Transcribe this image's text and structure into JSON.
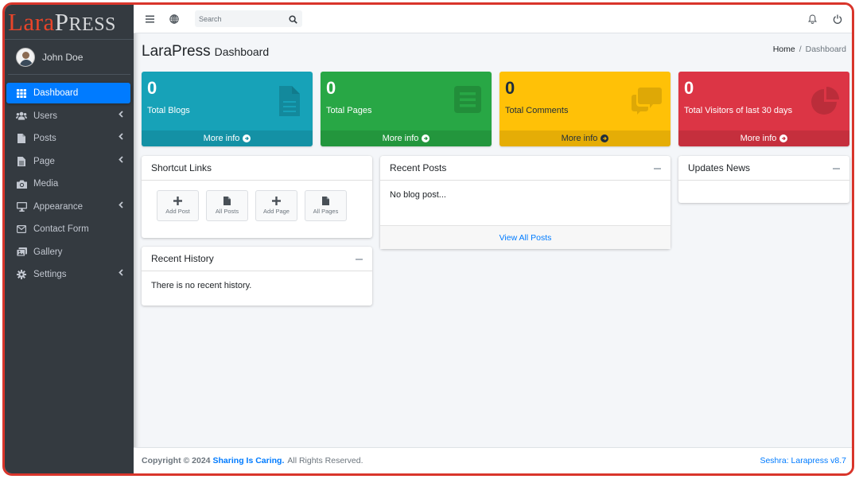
{
  "brand": {
    "part1": "Lara",
    "part2_big": "P",
    "part2_small": "RESS"
  },
  "user": {
    "name": "John Doe"
  },
  "sidebar": {
    "items": [
      {
        "label": "Dashboard",
        "icon": "grid-icon",
        "active": true,
        "has_children": false
      },
      {
        "label": "Users",
        "icon": "users-icon",
        "active": false,
        "has_children": true
      },
      {
        "label": "Posts",
        "icon": "file-icon",
        "active": false,
        "has_children": true
      },
      {
        "label": "Page",
        "icon": "file-icon",
        "active": false,
        "has_children": true
      },
      {
        "label": "Media",
        "icon": "camera-icon",
        "active": false,
        "has_children": false
      },
      {
        "label": "Appearance",
        "icon": "monitor-icon",
        "active": false,
        "has_children": true
      },
      {
        "label": "Contact Form",
        "icon": "envelope-icon",
        "active": false,
        "has_children": false
      },
      {
        "label": "Gallery",
        "icon": "images-icon",
        "active": false,
        "has_children": false
      },
      {
        "label": "Settings",
        "icon": "gear-icon",
        "active": false,
        "has_children": true
      }
    ]
  },
  "topbar": {
    "search_placeholder": "Search"
  },
  "page": {
    "title": "LaraPress",
    "subtitle": "Dashboard"
  },
  "breadcrumb": {
    "home": "Home",
    "separator": "/",
    "current": "Dashboard"
  },
  "stat_boxes": [
    {
      "value": "0",
      "label": "Total Blogs",
      "more": "More info",
      "color": "#17a2b8",
      "text_color": "#ffffff",
      "icon": "document-icon"
    },
    {
      "value": "0",
      "label": "Total Pages",
      "more": "More info",
      "color": "#28a745",
      "text_color": "#ffffff",
      "icon": "list-icon"
    },
    {
      "value": "0",
      "label": "Total Comments",
      "more": "More info",
      "color": "#ffc107",
      "text_color": "#1f2d3d",
      "icon": "comments-icon"
    },
    {
      "value": "0",
      "label": "Total Visitors of last 30 days",
      "more": "More info",
      "color": "#dc3545",
      "text_color": "#ffffff",
      "icon": "pie-chart-icon"
    }
  ],
  "shortcut_links": {
    "title": "Shortcut Links",
    "buttons": [
      {
        "label": "Add Post",
        "icon": "plus-icon"
      },
      {
        "label": "All Posts",
        "icon": "file-icon"
      },
      {
        "label": "Add Page",
        "icon": "plus-icon"
      },
      {
        "label": "All Pages",
        "icon": "file-icon"
      }
    ]
  },
  "recent_history": {
    "title": "Recent History",
    "empty": "There is no recent history."
  },
  "recent_posts": {
    "title": "Recent Posts",
    "empty": "No blog post...",
    "view_all": "View All Posts"
  },
  "updates_news": {
    "title": "Updates News"
  },
  "footer": {
    "copyright": "Copyright © 2024",
    "link": "Sharing Is Caring.",
    "rights": "All Rights Reserved.",
    "version": "Seshra: Larapress v8.7"
  }
}
